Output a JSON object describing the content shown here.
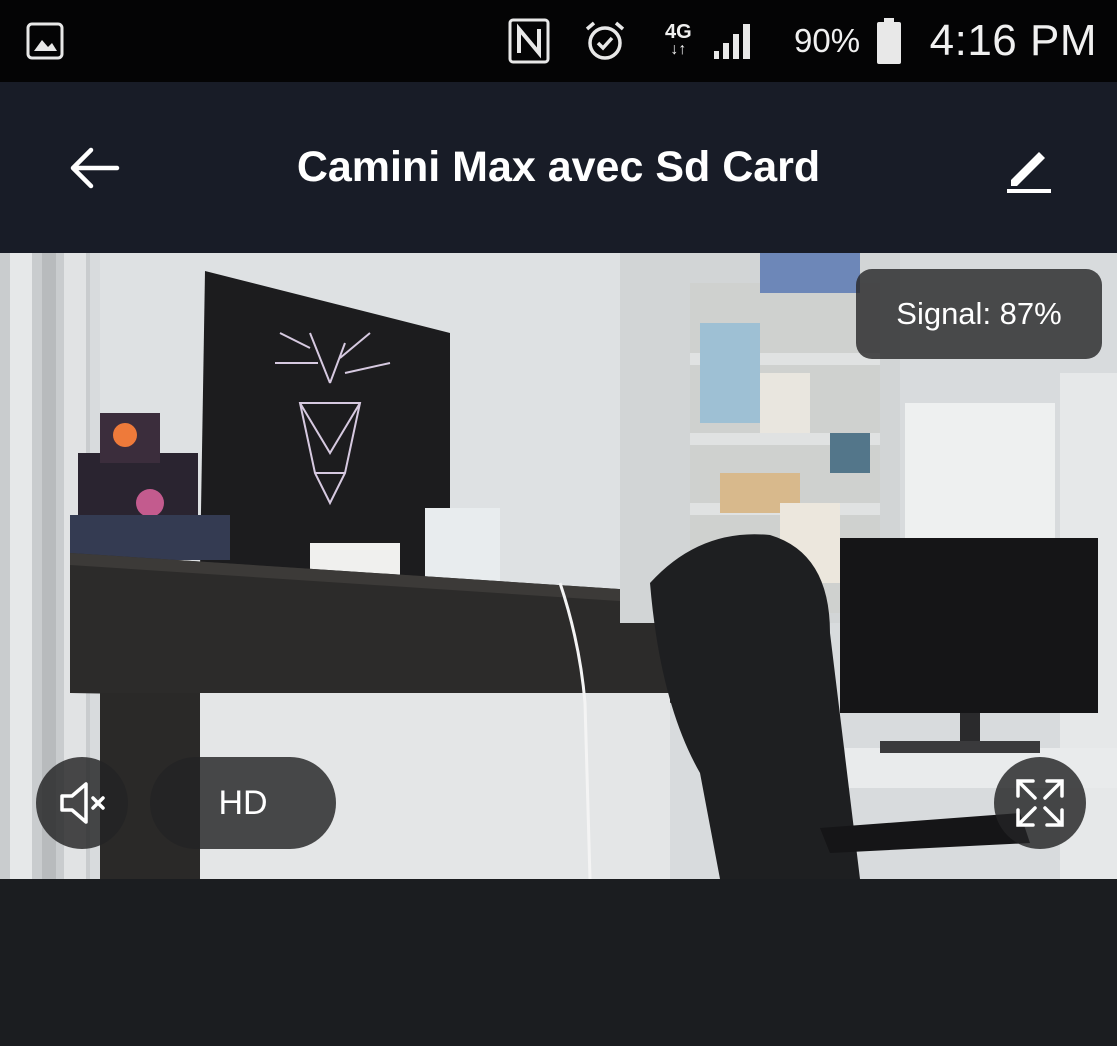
{
  "status_bar": {
    "icons": [
      "image-icon",
      "nfc-icon",
      "alarm-icon",
      "network-4g-icon",
      "signal-bars-icon",
      "battery-icon"
    ],
    "network_type": "4G",
    "battery_percent": "90%",
    "time": "4:16 PM"
  },
  "header": {
    "title": "Camini Max avec Sd Card",
    "back_icon": "arrow-left-icon",
    "edit_icon": "pencil-icon",
    "background": "#181c27"
  },
  "camera": {
    "signal_label": "Signal: 87%",
    "quality_label": "HD",
    "mute_icon": "speaker-muted-icon",
    "fullscreen_icon": "fullscreen-icon"
  }
}
